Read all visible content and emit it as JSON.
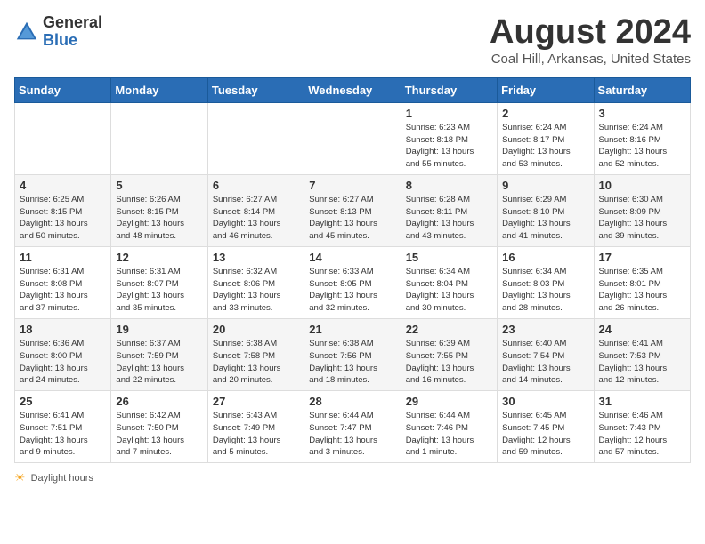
{
  "logo": {
    "general": "General",
    "blue": "Blue"
  },
  "header": {
    "month": "August 2024",
    "location": "Coal Hill, Arkansas, United States"
  },
  "days_of_week": [
    "Sunday",
    "Monday",
    "Tuesday",
    "Wednesday",
    "Thursday",
    "Friday",
    "Saturday"
  ],
  "weeks": [
    [
      {
        "day": "",
        "info": ""
      },
      {
        "day": "",
        "info": ""
      },
      {
        "day": "",
        "info": ""
      },
      {
        "day": "",
        "info": ""
      },
      {
        "day": "1",
        "info": "Sunrise: 6:23 AM\nSunset: 8:18 PM\nDaylight: 13 hours\nand 55 minutes."
      },
      {
        "day": "2",
        "info": "Sunrise: 6:24 AM\nSunset: 8:17 PM\nDaylight: 13 hours\nand 53 minutes."
      },
      {
        "day": "3",
        "info": "Sunrise: 6:24 AM\nSunset: 8:16 PM\nDaylight: 13 hours\nand 52 minutes."
      }
    ],
    [
      {
        "day": "4",
        "info": "Sunrise: 6:25 AM\nSunset: 8:15 PM\nDaylight: 13 hours\nand 50 minutes."
      },
      {
        "day": "5",
        "info": "Sunrise: 6:26 AM\nSunset: 8:15 PM\nDaylight: 13 hours\nand 48 minutes."
      },
      {
        "day": "6",
        "info": "Sunrise: 6:27 AM\nSunset: 8:14 PM\nDaylight: 13 hours\nand 46 minutes."
      },
      {
        "day": "7",
        "info": "Sunrise: 6:27 AM\nSunset: 8:13 PM\nDaylight: 13 hours\nand 45 minutes."
      },
      {
        "day": "8",
        "info": "Sunrise: 6:28 AM\nSunset: 8:11 PM\nDaylight: 13 hours\nand 43 minutes."
      },
      {
        "day": "9",
        "info": "Sunrise: 6:29 AM\nSunset: 8:10 PM\nDaylight: 13 hours\nand 41 minutes."
      },
      {
        "day": "10",
        "info": "Sunrise: 6:30 AM\nSunset: 8:09 PM\nDaylight: 13 hours\nand 39 minutes."
      }
    ],
    [
      {
        "day": "11",
        "info": "Sunrise: 6:31 AM\nSunset: 8:08 PM\nDaylight: 13 hours\nand 37 minutes."
      },
      {
        "day": "12",
        "info": "Sunrise: 6:31 AM\nSunset: 8:07 PM\nDaylight: 13 hours\nand 35 minutes."
      },
      {
        "day": "13",
        "info": "Sunrise: 6:32 AM\nSunset: 8:06 PM\nDaylight: 13 hours\nand 33 minutes."
      },
      {
        "day": "14",
        "info": "Sunrise: 6:33 AM\nSunset: 8:05 PM\nDaylight: 13 hours\nand 32 minutes."
      },
      {
        "day": "15",
        "info": "Sunrise: 6:34 AM\nSunset: 8:04 PM\nDaylight: 13 hours\nand 30 minutes."
      },
      {
        "day": "16",
        "info": "Sunrise: 6:34 AM\nSunset: 8:03 PM\nDaylight: 13 hours\nand 28 minutes."
      },
      {
        "day": "17",
        "info": "Sunrise: 6:35 AM\nSunset: 8:01 PM\nDaylight: 13 hours\nand 26 minutes."
      }
    ],
    [
      {
        "day": "18",
        "info": "Sunrise: 6:36 AM\nSunset: 8:00 PM\nDaylight: 13 hours\nand 24 minutes."
      },
      {
        "day": "19",
        "info": "Sunrise: 6:37 AM\nSunset: 7:59 PM\nDaylight: 13 hours\nand 22 minutes."
      },
      {
        "day": "20",
        "info": "Sunrise: 6:38 AM\nSunset: 7:58 PM\nDaylight: 13 hours\nand 20 minutes."
      },
      {
        "day": "21",
        "info": "Sunrise: 6:38 AM\nSunset: 7:56 PM\nDaylight: 13 hours\nand 18 minutes."
      },
      {
        "day": "22",
        "info": "Sunrise: 6:39 AM\nSunset: 7:55 PM\nDaylight: 13 hours\nand 16 minutes."
      },
      {
        "day": "23",
        "info": "Sunrise: 6:40 AM\nSunset: 7:54 PM\nDaylight: 13 hours\nand 14 minutes."
      },
      {
        "day": "24",
        "info": "Sunrise: 6:41 AM\nSunset: 7:53 PM\nDaylight: 13 hours\nand 12 minutes."
      }
    ],
    [
      {
        "day": "25",
        "info": "Sunrise: 6:41 AM\nSunset: 7:51 PM\nDaylight: 13 hours\nand 9 minutes."
      },
      {
        "day": "26",
        "info": "Sunrise: 6:42 AM\nSunset: 7:50 PM\nDaylight: 13 hours\nand 7 minutes."
      },
      {
        "day": "27",
        "info": "Sunrise: 6:43 AM\nSunset: 7:49 PM\nDaylight: 13 hours\nand 5 minutes."
      },
      {
        "day": "28",
        "info": "Sunrise: 6:44 AM\nSunset: 7:47 PM\nDaylight: 13 hours\nand 3 minutes."
      },
      {
        "day": "29",
        "info": "Sunrise: 6:44 AM\nSunset: 7:46 PM\nDaylight: 13 hours\nand 1 minute."
      },
      {
        "day": "30",
        "info": "Sunrise: 6:45 AM\nSunset: 7:45 PM\nDaylight: 12 hours\nand 59 minutes."
      },
      {
        "day": "31",
        "info": "Sunrise: 6:46 AM\nSunset: 7:43 PM\nDaylight: 12 hours\nand 57 minutes."
      }
    ]
  ],
  "footer": {
    "daylight_label": "Daylight hours"
  }
}
